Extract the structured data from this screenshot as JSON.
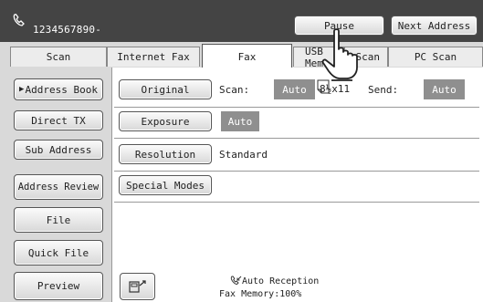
{
  "header": {
    "phone_number": "1234567890-",
    "pause_label": "Pause",
    "next_address_label": "Next Address"
  },
  "tabs": [
    {
      "label": "Scan"
    },
    {
      "label": "Internet Fax"
    },
    {
      "label": "Fax"
    },
    {
      "label": "USB Mem"
    },
    {
      "label": "Scan"
    },
    {
      "label": "PC Scan"
    }
  ],
  "sidebar": {
    "address_book": "Address Book",
    "direct_tx": "Direct TX",
    "sub_address": "Sub Address",
    "address_review": "Address Review",
    "file": "File",
    "quick_file": "Quick File",
    "preview": "Preview"
  },
  "main": {
    "original_label": "Original",
    "scan_label": "Scan:",
    "scan_value": "Auto",
    "paper_size": "8½x11",
    "send_label": "Send:",
    "send_value": "Auto",
    "exposure_label": "Exposure",
    "exposure_value": "Auto",
    "resolution_label": "Resolution",
    "resolution_value": "Standard",
    "special_modes_label": "Special Modes"
  },
  "status": {
    "auto_reception": "Auto Reception",
    "fax_memory": "Fax Memory:100%"
  },
  "colors": {
    "header_bg": "#444444",
    "chip_bg": "#8f8f8f"
  },
  "icons": [
    "phone-icon",
    "hand-pointer-icon",
    "paper-icon",
    "arrow-right-icon",
    "phone-receive-icon",
    "on-hook-dial-icon"
  ]
}
